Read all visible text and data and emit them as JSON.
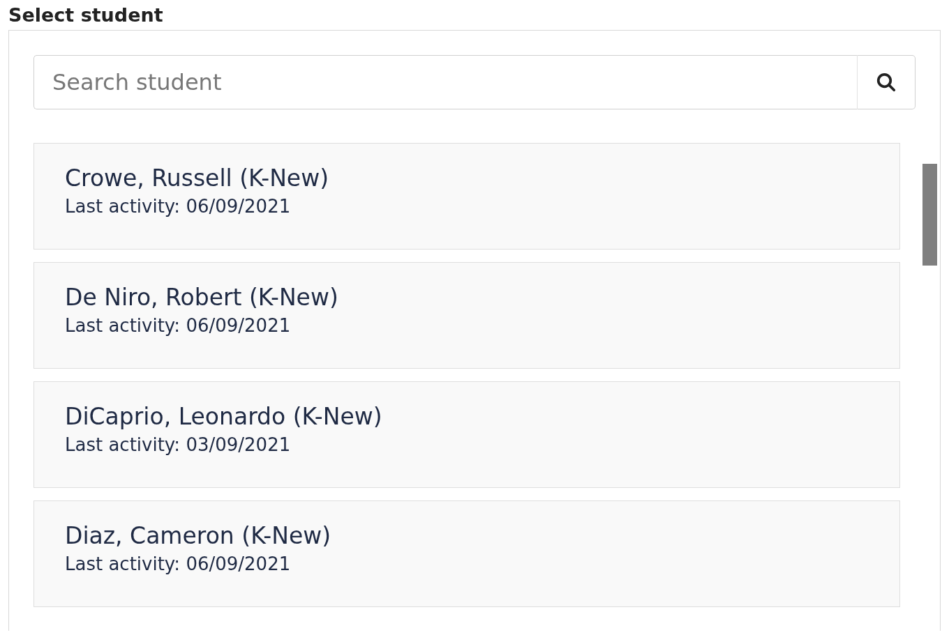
{
  "label": "Select student",
  "search": {
    "placeholder": "Search student"
  },
  "students": [
    {
      "name": "Crowe, Russell (K-New)",
      "activity": "Last activity: 06/09/2021"
    },
    {
      "name": "De Niro, Robert (K-New)",
      "activity": "Last activity: 06/09/2021"
    },
    {
      "name": "DiCaprio, Leonardo (K-New)",
      "activity": "Last activity: 03/09/2021"
    },
    {
      "name": "Diaz, Cameron (K-New)",
      "activity": "Last activity: 06/09/2021"
    }
  ]
}
